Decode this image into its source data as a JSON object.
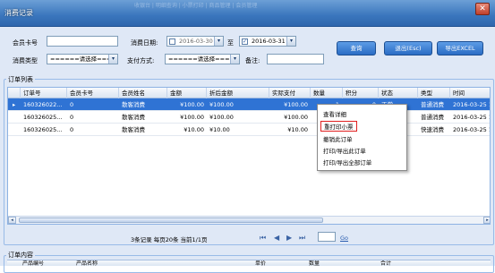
{
  "window": {
    "title": "消费记录",
    "ghost_title": "收银台 | 明细查询 | 小票打印 | 商品管理 | 会员管理",
    "close_glyph": "✕"
  },
  "filters": {
    "member_card_label": "会员卡号",
    "member_card_value": "",
    "consume_date_label": "消费日期:",
    "date_from": "2016-03-30",
    "date_to_label": "至",
    "date_to": "2016-03-31",
    "date_to_checked": "✓",
    "consume_type_label": "消费类型",
    "consume_type_value": "======请选择======",
    "pay_method_label": "支付方式:",
    "pay_method_value": "======请选择======",
    "remark_label": "备注:",
    "remark_value": ""
  },
  "buttons": {
    "query": "查询",
    "exit": "退出(Esc)",
    "export": "导出EXCEL"
  },
  "orders": {
    "legend": "订单列表",
    "columns": [
      "订单号",
      "会员卡号",
      "会员姓名",
      "金额",
      "折后金额",
      "实际支付",
      "数量",
      "积分",
      "状态",
      "类型",
      "时间"
    ],
    "rows": [
      {
        "order_no": "160326022...",
        "card": "0",
        "name": "散客消费",
        "amount": "¥100.00",
        "discount": "¥100.00",
        "paid": "¥100.00",
        "qty": "1",
        "points": "0",
        "status": "正常",
        "type": "普通消费",
        "time": "2016-03-25 1"
      },
      {
        "order_no": "160326025...",
        "card": "0",
        "name": "散客消费",
        "amount": "¥100.00",
        "discount": "¥100.00",
        "paid": "¥100.00",
        "qty": "",
        "points": "",
        "status": "",
        "type": "普通消费",
        "time": "2016-03-25 1"
      },
      {
        "order_no": "160326025...",
        "card": "0",
        "name": "散客消费",
        "amount": "¥10.00",
        "discount": "¥10.00",
        "paid": "¥10.00",
        "qty": "",
        "points": "",
        "status": "",
        "type": "快速消费",
        "time": "2016-03-25 1"
      }
    ],
    "scroll_left": "◂",
    "scroll_right": "▸"
  },
  "context_menu": {
    "items": [
      "查看详细",
      "重打印小票",
      "撤销此订单",
      "打印/导出此订单",
      "打印/导出全部订单"
    ],
    "highlighted_index": 1
  },
  "pager": {
    "summary": "3条记录 每页20条 当前1/1页",
    "first": "⏮",
    "prev": "◀",
    "next": "▶",
    "last": "⏭",
    "go": "Go",
    "page_input": ""
  },
  "order_content": {
    "legend": "订单内容",
    "columns": [
      "产品编号",
      "产品名称",
      "单价",
      "数量",
      "合计"
    ]
  }
}
